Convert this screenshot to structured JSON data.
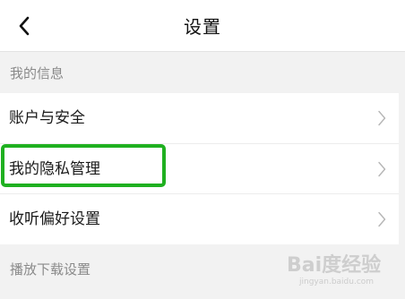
{
  "header": {
    "title": "设置",
    "back_icon": "chevron-left-icon"
  },
  "sections": [
    {
      "title": "我的信息",
      "items": [
        {
          "label": "账户与安全",
          "icon": "chevron-right-icon"
        },
        {
          "label": "我的隐私管理",
          "icon": "chevron-right-icon",
          "highlighted": true
        },
        {
          "label": "收听偏好设置",
          "icon": "chevron-right-icon"
        }
      ]
    },
    {
      "title": "播放下载设置",
      "items": []
    }
  ],
  "highlight_color": "#1fb020",
  "watermark": {
    "brand": "Bai度经验",
    "url": "jingyan.baidu.com"
  }
}
